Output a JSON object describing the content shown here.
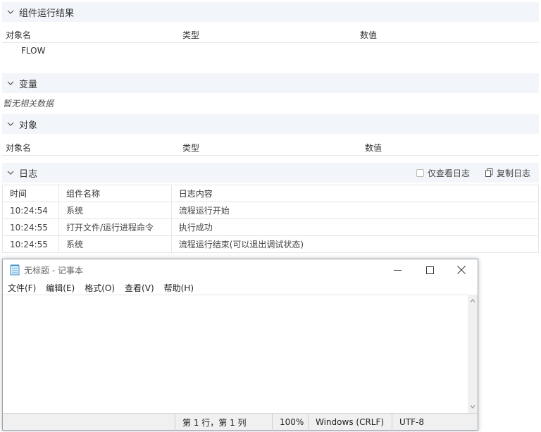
{
  "sections": {
    "results": {
      "title": "组件运行结果",
      "columns": [
        "对象名",
        "类型",
        "数值"
      ],
      "rows": [
        {
          "name": "FLOW"
        }
      ]
    },
    "variables": {
      "title": "变量",
      "empty": "暂无相关数据"
    },
    "objects": {
      "title": "对象",
      "columns": [
        "对象名",
        "类型",
        "数值"
      ]
    },
    "log": {
      "title": "日志",
      "only_view_log": "仅查看日志",
      "copy_log": "复制日志",
      "columns": [
        "时间",
        "组件名称",
        "日志内容"
      ],
      "rows": [
        {
          "time": "10:24:54",
          "component": "系统",
          "content": "流程运行开始"
        },
        {
          "time": "10:24:55",
          "component": "打开文件/运行进程命令",
          "content": "执行成功"
        },
        {
          "time": "10:24:55",
          "component": "系统",
          "content": "流程运行结束(可以退出调试状态)"
        }
      ]
    }
  },
  "notepad": {
    "title": "无标题 - 记事本",
    "menu": [
      "文件(F)",
      "编辑(E)",
      "格式(O)",
      "查看(V)",
      "帮助(H)"
    ],
    "status": {
      "position": "第 1 行，第 1 列",
      "zoom": "100%",
      "line_ending": "Windows (CRLF)",
      "encoding": "UTF-8"
    }
  },
  "icons": {
    "chevron": "chevron-down-icon",
    "copy": "copy-icon",
    "notepad": "notepad-icon",
    "minimize": "minimize-icon",
    "maximize": "maximize-icon",
    "close": "close-icon"
  },
  "colors": {
    "section_header_bg": "#f2f5fa",
    "border": "#e3e6eb"
  }
}
